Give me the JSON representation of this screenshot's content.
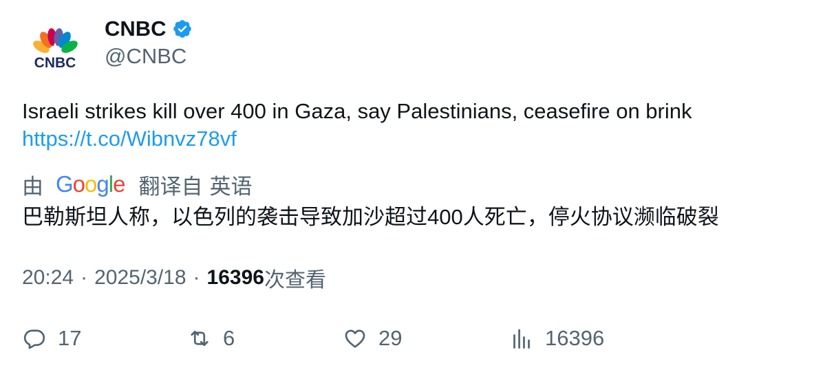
{
  "author": {
    "display_name": "CNBC",
    "handle": "@CNBC",
    "verified_icon": "verified-badge-icon",
    "avatar_logo_text": "CNBC"
  },
  "tweet": {
    "text": "Israeli strikes kill over 400 in Gaza, say Palestinians, ceasefire on brink",
    "link": "https://t.co/Wibnvz78vf"
  },
  "translation": {
    "by": "由",
    "provider": "Google",
    "translated_from": "翻译自",
    "language": "英语",
    "text": "巴勒斯坦人称，以色列的袭击导致加沙超过400人死亡，停火协议濒临破裂"
  },
  "meta": {
    "time": "20:24",
    "separator": "·",
    "date": "2025/3/18",
    "views_count": "16396",
    "views_label": "次查看"
  },
  "actions": {
    "reply_count": "17",
    "retweet_count": "6",
    "like_count": "29",
    "views_count": "16396"
  },
  "colors": {
    "link": "#1d9bf0",
    "secondary_text": "#536471",
    "primary_text": "#0f1419",
    "verified": "#1d9bf0"
  }
}
